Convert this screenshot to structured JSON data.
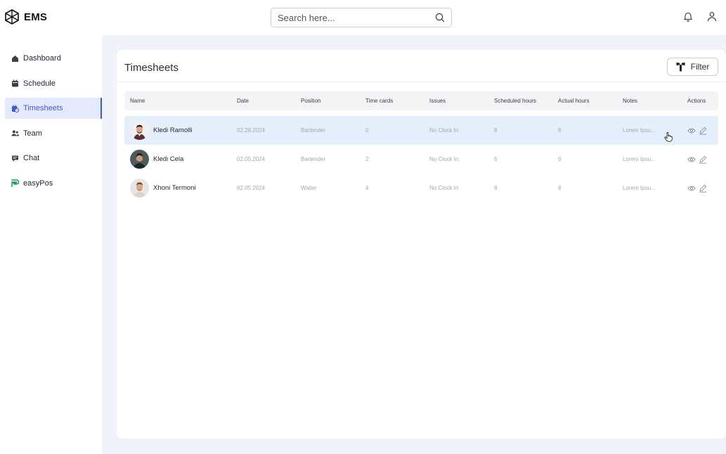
{
  "app": {
    "name": "EMS"
  },
  "search": {
    "placeholder": "Search here..."
  },
  "sidebar": {
    "items": [
      {
        "label": "Dashboard",
        "icon": "dashboard-icon",
        "active": false
      },
      {
        "label": "Schedule",
        "icon": "calendar-icon",
        "active": false
      },
      {
        "label": "Timesheets",
        "icon": "timesheet-icon",
        "active": true
      },
      {
        "label": "Team",
        "icon": "team-icon",
        "active": false
      },
      {
        "label": "Chat",
        "icon": "chat-icon",
        "active": false
      },
      {
        "label": "easyPos",
        "icon": "easypos-icon",
        "active": false
      }
    ]
  },
  "page": {
    "title": "Timesheets",
    "filter_label": "Filter"
  },
  "table": {
    "columns": [
      "Name",
      "Date",
      "Position",
      "Time cards",
      "Issues",
      "Scheduled hours",
      "Actual hours",
      "Notes",
      "Actions"
    ],
    "rows": [
      {
        "name": "Kledi Ramolli",
        "date": "02.28.2024",
        "position": "Bartender",
        "time_cards": "0",
        "issues": "No Clock In",
        "scheduled": "8",
        "actual": "8",
        "notes": "Lorem Ipsu..."
      },
      {
        "name": "Kledi Cela",
        "date": "02.05.2024",
        "position": "Bartender",
        "time_cards": "2",
        "issues": "No Clock In",
        "scheduled": "6",
        "actual": "6",
        "notes": "Lorem Ipsu..."
      },
      {
        "name": "Xhoni Termoni",
        "date": "02.05.2024",
        "position": "Waiter",
        "time_cards": "4",
        "issues": "No Clock In",
        "scheduled": "8",
        "actual": "8",
        "notes": "Lorem Ipsu..."
      }
    ]
  },
  "colors": {
    "accent": "#3d5bd9",
    "active_bg": "#e4e9fb",
    "content_bg": "#f0f3f9",
    "hover_row": "#e5eefb",
    "easypos_green": "#1aa35c"
  }
}
